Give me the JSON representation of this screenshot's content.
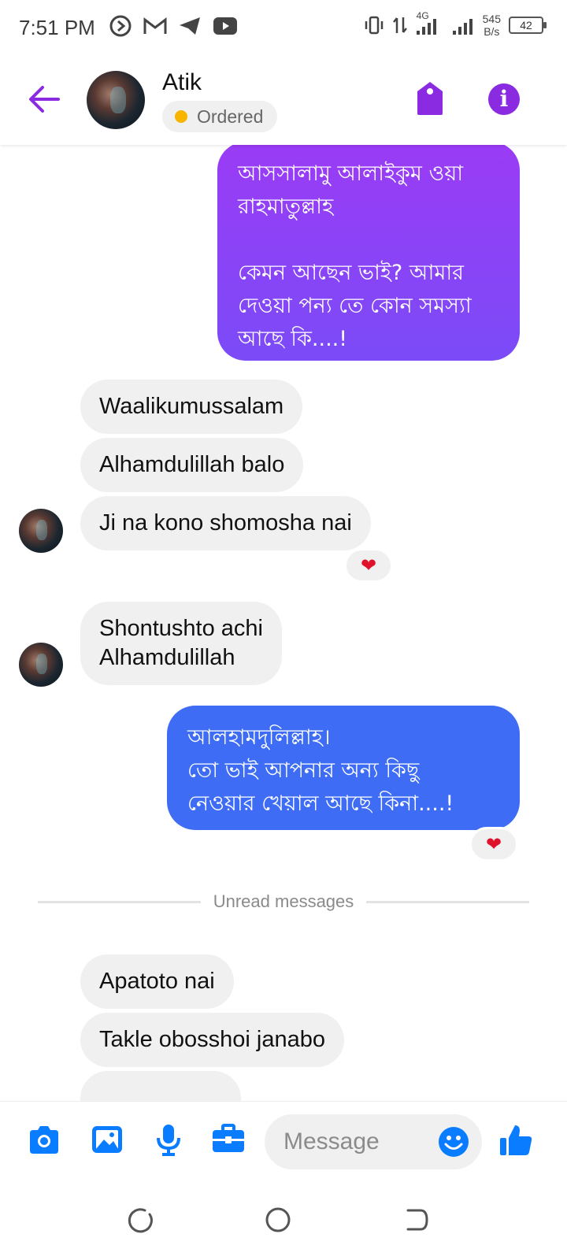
{
  "status_bar": {
    "time": "7:51 PM",
    "network_type": "4G",
    "speed_value": "545",
    "speed_unit": "B/s",
    "battery": "42"
  },
  "header": {
    "contact_name": "Atik",
    "status_label": "Ordered",
    "status_color": "#f7b500",
    "accent_color": "#8a2be2"
  },
  "messages": [
    {
      "direction": "out",
      "style": "purple",
      "text": "আসসালামু আলাইকুম ওয়া\nরাহমাতুল্লাহ\n\nকেমন আছেন ভাই? আমার\nদেওয়া পন্য তে কোন সমস্যা\nআছে কি....!"
    },
    {
      "direction": "in",
      "text": "Waalikumussalam"
    },
    {
      "direction": "in",
      "text": "Alhamdulillah balo"
    },
    {
      "direction": "in",
      "text": "Ji na kono shomosha nai",
      "reaction": "❤"
    },
    {
      "direction": "in",
      "text": "Shontushto achi\nAlhamdulillah"
    },
    {
      "direction": "out",
      "style": "blue",
      "text": "আলহামদুলিল্লাহ।\nতো ভাই আপনার অন্য কিছু\nনেওয়ার খেয়াল আছে কিনা....!",
      "reaction": "❤"
    },
    {
      "direction": "in",
      "text": "Apatoto nai"
    },
    {
      "direction": "in",
      "text": "Takle obosshoi janabo"
    }
  ],
  "unread_divider": "Unread messages",
  "composer": {
    "placeholder": "Message",
    "icons": [
      "camera-icon",
      "image-icon",
      "microphone-icon",
      "briefcase-icon",
      "emoji-icon",
      "thumbs-up-icon"
    ]
  },
  "colors": {
    "messenger_blue": "#0a7cff",
    "outgoing_blue": "#3e6cf5",
    "outgoing_purple": "#9a3bf5",
    "incoming_gray": "#f0f0f0"
  }
}
